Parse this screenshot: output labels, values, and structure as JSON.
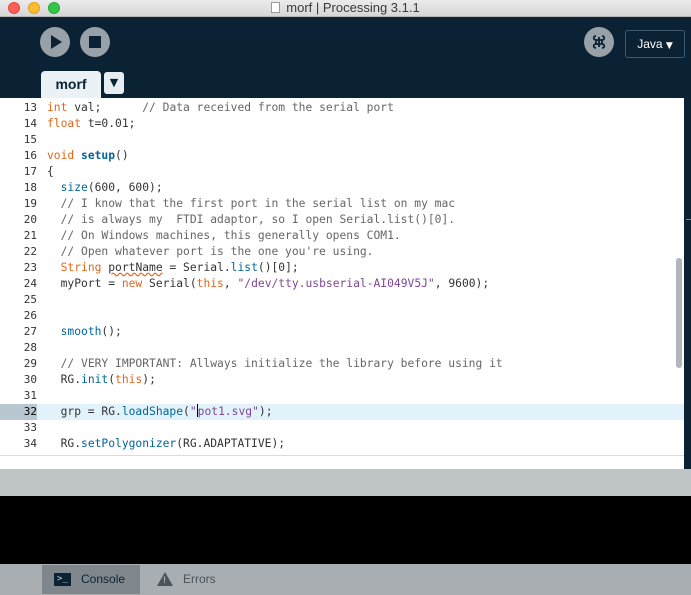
{
  "window": {
    "title": "morf | Processing 3.1.1"
  },
  "toolbar": {
    "run_icon": "play-icon",
    "stop_icon": "stop-icon",
    "debug_icon": "debugger-icon",
    "mode_label": "Java",
    "mode_caret": "▼"
  },
  "tabs": [
    {
      "label": "morf"
    }
  ],
  "tab_menu_caret": "▼",
  "editor": {
    "active_line": 32,
    "lines": [
      {
        "n": "13",
        "code": "int val;      // Data received from the serial port"
      },
      {
        "n": "14",
        "code": "float t=0.01;"
      },
      {
        "n": "15",
        "code": ""
      },
      {
        "n": "16",
        "code": "void setup()"
      },
      {
        "n": "17",
        "code": "{"
      },
      {
        "n": "18",
        "code": "  size(600, 600);"
      },
      {
        "n": "19",
        "code": "  // I know that the first port in the serial list on my mac"
      },
      {
        "n": "20",
        "code": "  // is always my  FTDI adaptor, so I open Serial.list()[0]."
      },
      {
        "n": "21",
        "code": "  // On Windows machines, this generally opens COM1."
      },
      {
        "n": "22",
        "code": "  // Open whatever port is the one you're using."
      },
      {
        "n": "23",
        "code": "  String portName = Serial.list()[0];"
      },
      {
        "n": "24",
        "code": "  myPort = new Serial(this, \"/dev/tty.usbserial-AI049V5J\", 9600);"
      },
      {
        "n": "25",
        "code": ""
      },
      {
        "n": "26",
        "code": ""
      },
      {
        "n": "27",
        "code": "  smooth();"
      },
      {
        "n": "28",
        "code": ""
      },
      {
        "n": "29",
        "code": "  // VERY IMPORTANT: Allways initialize the library before using it"
      },
      {
        "n": "30",
        "code": "  RG.init(this);"
      },
      {
        "n": "31",
        "code": ""
      },
      {
        "n": "32",
        "code": "  grp = RG.loadShape(\"pot1.svg\");"
      },
      {
        "n": "33",
        "code": ""
      },
      {
        "n": "34",
        "code": "  RG.setPolygonizer(RG.ADAPTATIVE);"
      }
    ]
  },
  "bottom_tabs": {
    "console": {
      "label": "Console",
      "icon": "console-icon"
    },
    "errors": {
      "label": "Errors",
      "icon": "warning-icon"
    }
  },
  "colors": {
    "background": "#0b2134",
    "keyword": "#e2661a",
    "function": "#006699",
    "comment": "#666666",
    "string": "#7d4793",
    "active_line": "#e2f2fa"
  }
}
